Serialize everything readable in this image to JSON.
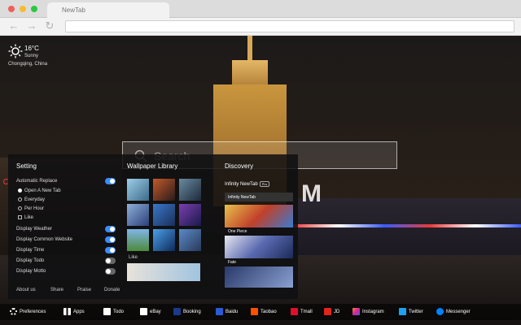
{
  "window": {
    "tab_title": "NewTab"
  },
  "weather": {
    "temperature": "16°C",
    "condition": "Sunny",
    "location": "Chongqing,  China"
  },
  "search": {
    "placeholder": "Search"
  },
  "logo": {
    "partial_text": "M"
  },
  "settings": {
    "title": "Setting",
    "automatic_replace": {
      "label": "Automatic Replace",
      "on": true
    },
    "replace_options": [
      {
        "label": "Open A New Tab",
        "selected": true
      },
      {
        "label": "Everyday",
        "selected": false
      },
      {
        "label": "Per Hour",
        "selected": false
      }
    ],
    "like_label": "Like",
    "toggles": [
      {
        "label": "Display Weather",
        "on": true
      },
      {
        "label": "Display Common Website",
        "on": true
      },
      {
        "label": "Display Time",
        "on": true
      },
      {
        "label": "Display Todo",
        "on": false
      },
      {
        "label": "Display Motto",
        "on": false
      }
    ],
    "footer": [
      "About us",
      "Share",
      "Praise",
      "Donate"
    ]
  },
  "wallpaper": {
    "title": "Wallpaper Library",
    "like_label": "Like"
  },
  "discovery": {
    "title": "Discovery",
    "header_label": "Infinity NewTab",
    "header_badge": "Pro",
    "subheader": "Infinity NewTab",
    "items": [
      "One Piece",
      "Fate"
    ]
  },
  "bottom_bar": {
    "items": [
      {
        "label": "Preferences",
        "icon": "gear-icon",
        "color": "#ffffff"
      },
      {
        "label": "Apps",
        "icon": "grid-icon",
        "color": "#ffffff"
      },
      {
        "label": "Todo",
        "icon": "checkbox-icon",
        "color": "#ffffff"
      },
      {
        "label": "eBay",
        "icon": "ebay-icon",
        "color": "#ffffff"
      },
      {
        "label": "Booking",
        "icon": "booking-icon",
        "color": "#1d3a8a"
      },
      {
        "label": "Baidu",
        "icon": "baidu-icon",
        "color": "#2a5bd7"
      },
      {
        "label": "Taobao",
        "icon": "taobao-icon",
        "color": "#ff5000"
      },
      {
        "label": "Tmall",
        "icon": "tmall-icon",
        "color": "#e0102d"
      },
      {
        "label": "JD",
        "icon": "jd-icon",
        "color": "#e1251b"
      },
      {
        "label": "Instagram",
        "icon": "instagram-icon",
        "color": "#d6249f"
      },
      {
        "label": "Twitter",
        "icon": "twitter-icon",
        "color": "#1da1f2"
      },
      {
        "label": "Messenger",
        "icon": "messenger-icon",
        "color": "#0084ff"
      }
    ]
  }
}
